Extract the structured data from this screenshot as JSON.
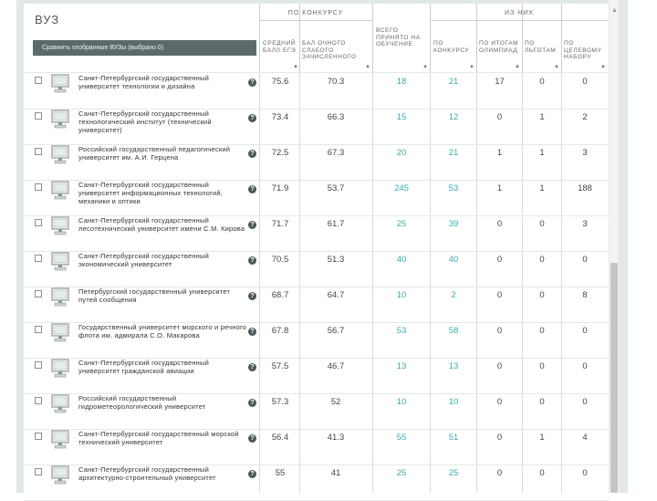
{
  "header": {
    "vuz_label": "ВУЗ",
    "compare_button": "Сравнить отобранные ВУЗы (выбрано 0)",
    "group_contest": "ПО КОНКУРСУ",
    "group_of_them": "ИЗ НИХ",
    "col_avg": "СРЕДНИЙ БАЛЛ ЕГЭ",
    "col_weak": "БАЛ ОЧНОГО СЛАБОГО ЗАЧИСЛЕННОГО",
    "col_total": "ВСЕГО ПРИНЯТО НА ОБУЧЕНИЕ",
    "col_contest": "ПО КОНКУРСУ",
    "col_olymp": "ПО ИТОГАМ ОЛИМПИАД",
    "col_benefit": "ПО ЛЬГОТАМ",
    "col_target": "ПО ЦЕЛЕВОМУ НАБОРУ",
    "sort_icon": "sort-arrows-icon"
  },
  "accent_color": "#3aaab0",
  "rows": [
    {
      "name": "Санкт-Петербургский государственный университет технологии и дизайна",
      "avg": "75.6",
      "weak": "70.3",
      "total": "18",
      "contest": "21",
      "olymp": "17",
      "benefit": "0",
      "target": "0"
    },
    {
      "name": "Санкт-Петербургский государственный технологический институт (технический университет)",
      "avg": "73.4",
      "weak": "66.3",
      "total": "15",
      "contest": "12",
      "olymp": "0",
      "benefit": "1",
      "target": "2"
    },
    {
      "name": "Российский государственный педагогический университет им. А.И. Герцена",
      "avg": "72.5",
      "weak": "67.3",
      "total": "20",
      "contest": "21",
      "olymp": "1",
      "benefit": "1",
      "target": "3"
    },
    {
      "name": "Санкт-Петербургский государственный университет информационных технологий, механики и оптики",
      "avg": "71.9",
      "weak": "53.7",
      "total": "245",
      "contest": "53",
      "olymp": "1",
      "benefit": "1",
      "target": "188"
    },
    {
      "name": "Санкт-Петербургский государственный лесотехнический университет имени С.М. Кирова",
      "avg": "71.7",
      "weak": "61.7",
      "total": "25",
      "contest": "39",
      "olymp": "0",
      "benefit": "0",
      "target": "3"
    },
    {
      "name": "Санкт-Петербургский государственный экономический университет",
      "avg": "70.5",
      "weak": "51.3",
      "total": "40",
      "contest": "40",
      "olymp": "0",
      "benefit": "0",
      "target": "0"
    },
    {
      "name": "Петербургский государственный университет путей сообщения",
      "avg": "68.7",
      "weak": "64.7",
      "total": "10",
      "contest": "2",
      "olymp": "0",
      "benefit": "0",
      "target": "8"
    },
    {
      "name": "Государственный университет морского и речного флота им. адмирала С.О. Макарова",
      "avg": "67.8",
      "weak": "56.7",
      "total": "53",
      "contest": "58",
      "olymp": "0",
      "benefit": "0",
      "target": "0"
    },
    {
      "name": "Санкт-Петербургский государственный университет гражданской авиации",
      "avg": "57.5",
      "weak": "46.7",
      "total": "13",
      "contest": "13",
      "olymp": "0",
      "benefit": "0",
      "target": "0"
    },
    {
      "name": "Российский государственный гидрометеорологический университет",
      "avg": "57.3",
      "weak": "52",
      "total": "10",
      "contest": "10",
      "olymp": "0",
      "benefit": "0",
      "target": "0"
    },
    {
      "name": "Санкт-Петербургский государственный морской технический университет",
      "avg": "56.4",
      "weak": "41.3",
      "total": "55",
      "contest": "51",
      "olymp": "0",
      "benefit": "1",
      "target": "4"
    },
    {
      "name": "Санкт-Петербургский государственный архитектурно-строительный университет",
      "avg": "55",
      "weak": "41",
      "total": "25",
      "contest": "25",
      "olymp": "0",
      "benefit": "0",
      "target": "0"
    }
  ]
}
